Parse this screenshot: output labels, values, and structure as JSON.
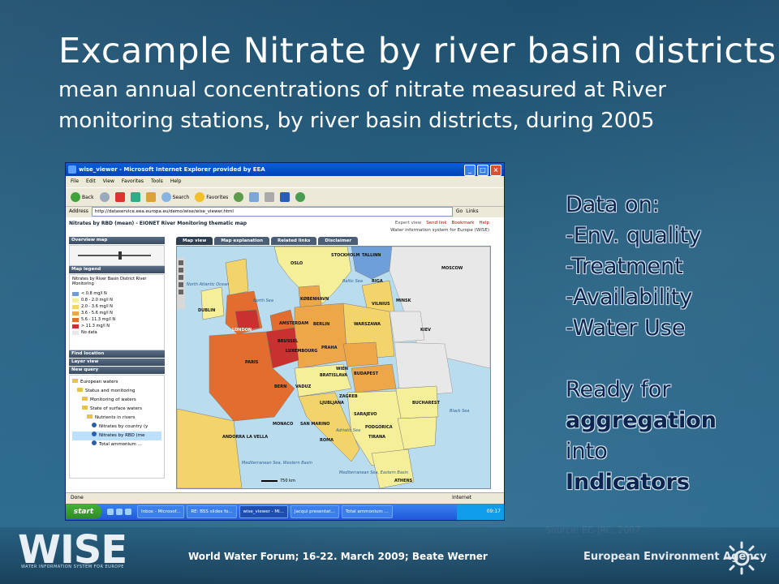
{
  "slide": {
    "title": "Excample Nitrate by river basin districts",
    "subtitle": "mean annual concentrations of nitrate measured at River monitoring stations, by river basin districts, during 2005",
    "bullets": [
      "Data on:",
      "-Env. quality",
      "-Treatment",
      "-Availability",
      "-Water Use"
    ],
    "ready": {
      "line1": "Ready for",
      "line2": "aggregation",
      "line3": "into",
      "line4": "Indicators"
    },
    "source": "Source: EC-JRC, 2007",
    "footer_text": "World Water Forum; 16-22. March 2009; Beate Werner",
    "agency_name": "European Environment Agency",
    "logo_text": "WISE",
    "logo_sub": "WATER INFORMATION SYSTEM FOR EUROPE"
  },
  "browser": {
    "title": "wise_viewer - Microsoft Internet Explorer provided by EEA",
    "menu": [
      "File",
      "Edit",
      "View",
      "Favorites",
      "Tools",
      "Help"
    ],
    "toolbar": {
      "back": "Back",
      "search": "Search",
      "favorites": "Favorites"
    },
    "address_label": "Address",
    "address": "http://dataservice.eea.europa.eu/demo/wise/wise_viewer.html",
    "go": "Go",
    "links": "Links",
    "status_left": "Done",
    "status_right": "Internet"
  },
  "viewer": {
    "page_title": "Nitrates by RBD (mean) - EIONET River Monitoring thematic map",
    "links": {
      "expert": "Expert view",
      "send": "Send link",
      "bookmark": "Bookmark",
      "help": "Help"
    },
    "wise_sub": "Water information system for Europe (WISE)",
    "panel_heads": {
      "overview": "Overview map",
      "legend": "Map legend",
      "find": "Find location",
      "layer": "Layer view",
      "query": "New query"
    },
    "legend_title": "Nitrates by River Basin District River Monitoring",
    "legend": [
      {
        "label": "< 0.8 mg/l N",
        "color": "#6f9fd8"
      },
      {
        "label": "0.8 - 2.0 mg/l N",
        "color": "#f6ef9a"
      },
      {
        "label": "2.0 - 3.6 mg/l N",
        "color": "#f3d46a"
      },
      {
        "label": "3.6 - 5.6 mg/l N",
        "color": "#eea748"
      },
      {
        "label": "5.6 - 11.3 mg/l N",
        "color": "#e36d2e"
      },
      {
        "label": "> 11.3 mg/l N",
        "color": "#c93030"
      },
      {
        "label": "No data",
        "color": "#e8e8e8"
      }
    ],
    "tree": [
      "European waters",
      "Status and monitoring",
      "Monitoring of waters",
      "State of surface waters",
      "Nutrients in rivers",
      "Nitrates by country (y",
      "Nitrates by RBD (me",
      "Total ammonium ..."
    ],
    "tabs": [
      "Map view",
      "Map explanation",
      "Related links",
      "Disclaimer"
    ],
    "cities": [
      "OSLO",
      "STOCKHOLM",
      "TALLINN",
      "MOSCOW",
      "RIGA",
      "KØBENHAVN",
      "VILNIUS",
      "MINSK",
      "DUBLIN",
      "AMSTERDAM",
      "BERLIN",
      "WARSZAWA",
      "LONDON",
      "BRUSSEL",
      "LUXEMBOURG",
      "PRAHA",
      "KIEV",
      "PARIS",
      "WIEN",
      "BRATISLAVA",
      "BUDAPEST",
      "BERN",
      "VADUZ",
      "LJUBLJANA",
      "ZAGREB",
      "BUCHAREST",
      "MONACO",
      "SAN MARINO",
      "SARAJEVO",
      "ANDORRA LA VELLA",
      "ROMA",
      "PODGORICA",
      "TIRANA",
      "ATHENS"
    ],
    "seas": [
      "North Atlantic Ocean",
      "North Sea",
      "Baltic Sea",
      "Black Sea",
      "Adriatic Sea",
      "Mediterranean Sea, Western Basin",
      "Mediterranean Sea, Eastern Basin"
    ],
    "scale": "750 km"
  },
  "taskbar": {
    "start": "start",
    "tasks": [
      "Inbox - Microsof...",
      "RE: BSS slides fo...",
      "wise_viewer - Mi...",
      "Jacqui presentat...",
      "Total ammonium ..."
    ],
    "clock": "09:17"
  }
}
